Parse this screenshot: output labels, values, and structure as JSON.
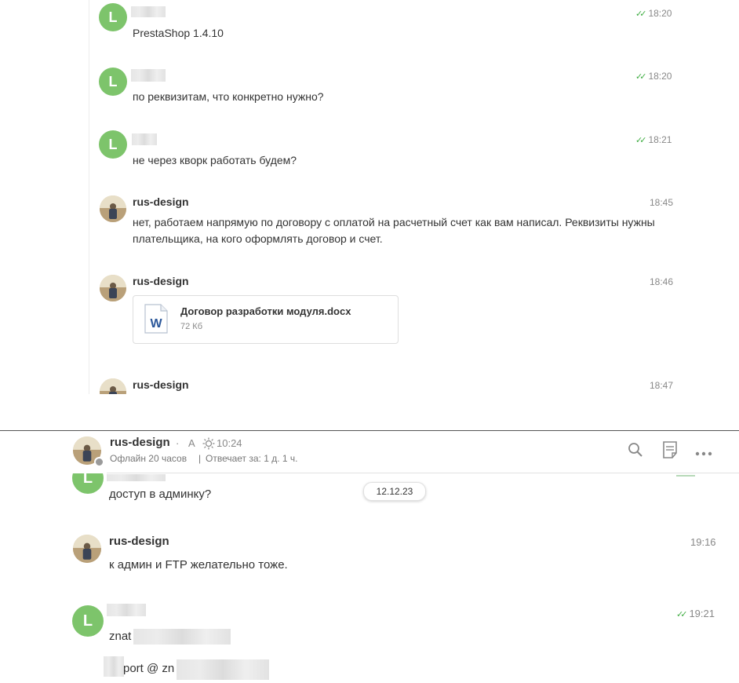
{
  "top": {
    "messages": [
      {
        "avatar_letter": "L",
        "time": "18:20",
        "read": true,
        "text": "PrestaShop 1.4.10"
      },
      {
        "avatar_letter": "L",
        "time": "18:20",
        "read": true,
        "text": "по реквизитам, что конкретно нужно?"
      },
      {
        "avatar_letter": "L",
        "time": "18:21",
        "read": true,
        "text": "не через кворк работать будем?"
      },
      {
        "author": "rus-design",
        "time": "18:45",
        "text_line1": "нет, работаем напрямую по договору с оплатой на расчетный счет как вам написал. Реквизиты нужны",
        "text_line2": "плательщика, на кого оформлять договор и счет."
      },
      {
        "author": "rus-design",
        "time": "18:46",
        "file": {
          "name": "Договор разработки модуля.docx",
          "size": "72 Кб",
          "icon_letter": "W"
        }
      },
      {
        "author": "rus-design",
        "time": "18:47"
      }
    ]
  },
  "bottom": {
    "header": {
      "name": "rus-design",
      "separator": "·",
      "letter": "A",
      "local_time": "10:24",
      "status": "Офлайн 20 часов",
      "response": "Отвечает за: 1 д. 1 ч."
    },
    "date_badge": "12.12.23",
    "messages": [
      {
        "avatar_letter": "L",
        "text": "доступ в админку?"
      },
      {
        "author": "rus-design",
        "time": "19:16",
        "text": "к админ и FTP желательно тоже."
      },
      {
        "avatar_letter": "L",
        "time": "19:21",
        "read": true,
        "line1": "znat",
        "line2": "port @ zn"
      }
    ]
  },
  "icons": {
    "search": "search-icon",
    "notes": "notes-icon",
    "more": "more-icon",
    "sun": "sun-icon",
    "read_ticks": "double-check-icon"
  },
  "colors": {
    "avatar_green": "#7dc46b",
    "tick_green": "#3fad42",
    "word_blue": "#2b579a"
  }
}
